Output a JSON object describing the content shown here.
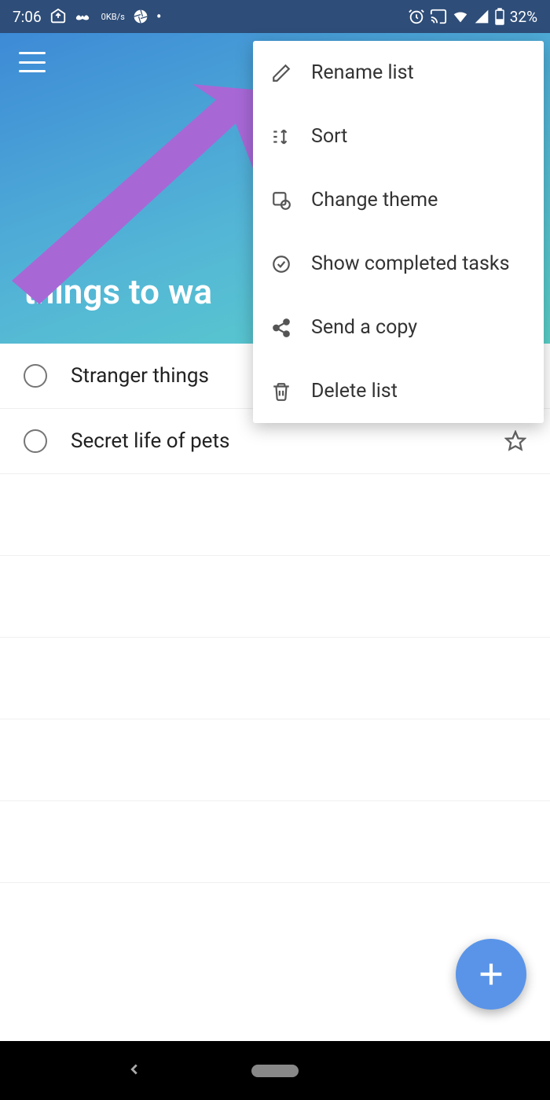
{
  "status": {
    "time": "7:06",
    "speed_value": "0",
    "speed_unit": "KB/s",
    "battery_text": "32%"
  },
  "header": {
    "list_title": "things to wa"
  },
  "menu": {
    "items": [
      {
        "label": "Rename list",
        "icon": "pencil-icon"
      },
      {
        "label": "Sort",
        "icon": "sort-icon"
      },
      {
        "label": "Change theme",
        "icon": "theme-icon"
      },
      {
        "label": "Show completed tasks",
        "icon": "check-circle-icon"
      },
      {
        "label": "Send a copy",
        "icon": "share-icon"
      },
      {
        "label": "Delete list",
        "icon": "trash-icon"
      }
    ]
  },
  "tasks": [
    {
      "title": "Stranger things",
      "starred": false
    },
    {
      "title": "Secret life of pets",
      "starred": true
    }
  ],
  "colors": {
    "accent": "#5a94e8",
    "status_bg": "#2e4d78",
    "arrow": "#a768d6"
  }
}
